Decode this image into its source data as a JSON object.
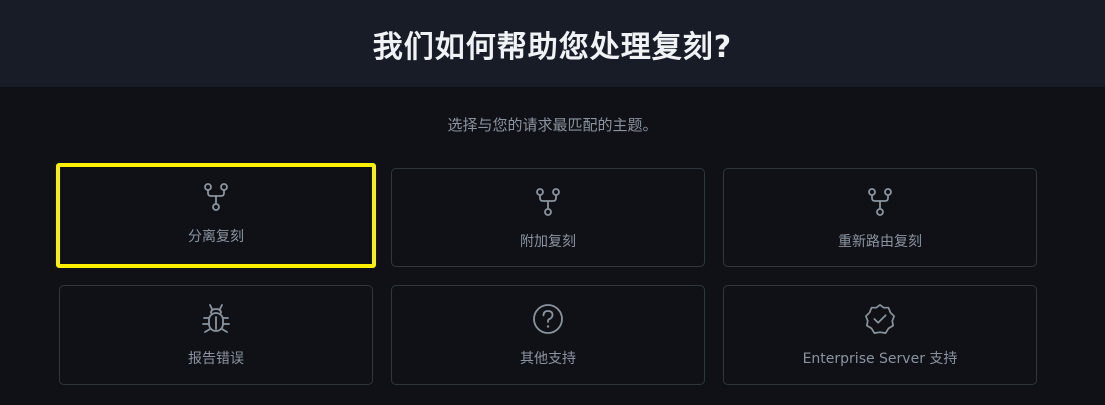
{
  "header": {
    "title": "我们如何帮助您处理复刻?"
  },
  "subtitle": "选择与您的请求最匹配的主题。",
  "cards": [
    {
      "label": "分离复刻",
      "icon": "repo-forked-icon",
      "selected": true
    },
    {
      "label": "附加复刻",
      "icon": "repo-forked-icon",
      "selected": false
    },
    {
      "label": "重新路由复刻",
      "icon": "repo-forked-icon",
      "selected": false
    },
    {
      "label": "报告错误",
      "icon": "bug-icon",
      "selected": false
    },
    {
      "label": "其他支持",
      "icon": "question-icon",
      "selected": false
    },
    {
      "label": "Enterprise Server 支持",
      "icon": "verified-badge-icon",
      "selected": false
    }
  ],
  "colors": {
    "background": "#0f1117",
    "header_background": "#181c26",
    "card_border": "#30363d",
    "text_muted": "#8b949e",
    "title_text": "#f0f3f6",
    "highlight": "#fdf100"
  }
}
